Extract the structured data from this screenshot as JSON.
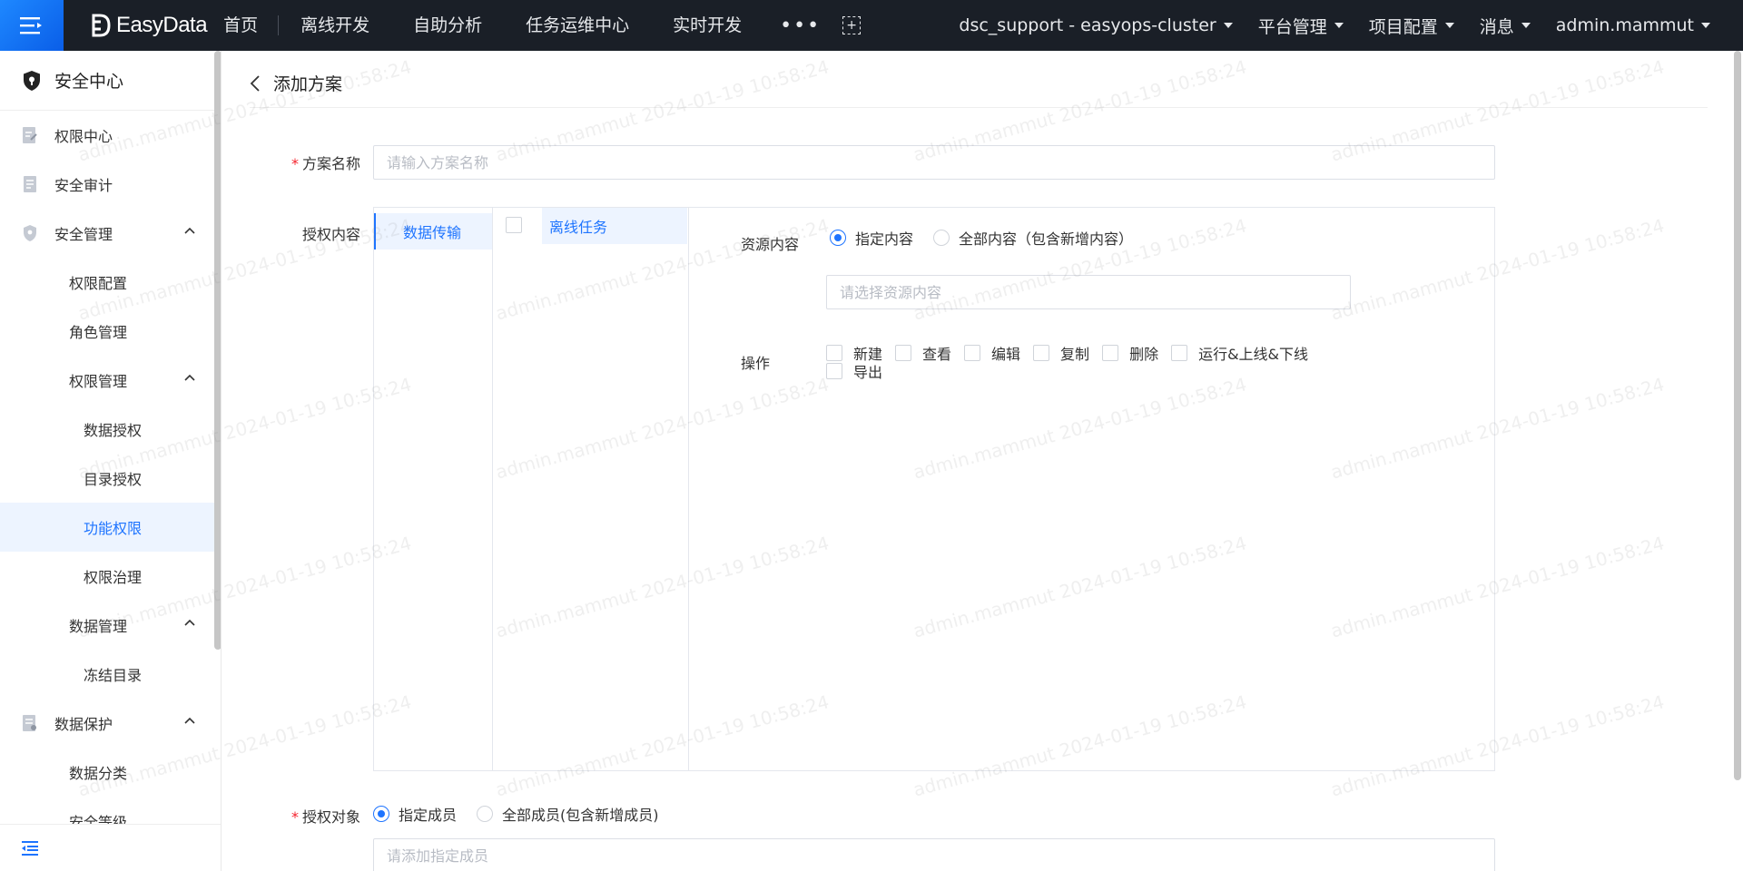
{
  "topbar": {
    "brand": "EasyData",
    "nav": [
      "首页",
      "离线开发",
      "自助分析",
      "任务运维中心",
      "实时开发"
    ],
    "more": "•••",
    "cluster": "dsc_support - easyops-cluster",
    "platform": "平台管理",
    "project": "项目配置",
    "messages": "消息",
    "user": "admin.mammut"
  },
  "sidebar": {
    "title": "安全中心",
    "items": [
      {
        "label": "权限中心",
        "level": 1
      },
      {
        "label": "安全审计",
        "level": 1
      },
      {
        "label": "安全管理",
        "level": 1,
        "expanded": true
      },
      {
        "label": "权限配置",
        "level": 2
      },
      {
        "label": "角色管理",
        "level": 2
      },
      {
        "label": "权限管理",
        "level": 2,
        "expanded": true
      },
      {
        "label": "数据授权",
        "level": 3
      },
      {
        "label": "目录授权",
        "level": 3
      },
      {
        "label": "功能权限",
        "level": 3,
        "active": true
      },
      {
        "label": "权限治理",
        "level": 3
      },
      {
        "label": "数据管理",
        "level": 2,
        "expanded": true
      },
      {
        "label": "冻结目录",
        "level": 3
      },
      {
        "label": "数据保护",
        "level": 1,
        "expanded": true
      },
      {
        "label": "数据分类",
        "level": 2
      },
      {
        "label": "安全等级",
        "level": 2
      }
    ]
  },
  "page": {
    "title": "添加方案",
    "scheme_name_label": "方案名称",
    "scheme_name_placeholder": "请输入方案名称",
    "auth_content_label": "授权内容",
    "category": "数据传输",
    "subcategory": "离线任务",
    "resource_label": "资源内容",
    "resource_opt_specified": "指定内容",
    "resource_opt_all": "全部内容（包含新增内容）",
    "resource_placeholder": "请选择资源内容",
    "ops_label": "操作",
    "ops": [
      "新建",
      "查看",
      "编辑",
      "复制",
      "删除",
      "运行&上线&下线",
      "导出"
    ],
    "target_label": "授权对象",
    "target_opt_specified": "指定成员",
    "target_opt_all": "全部成员(包含新增成员)",
    "target_placeholder": "请添加指定成员"
  },
  "watermark": "admin.mammut 2024-01-19 10:58:24",
  "colors": {
    "accent": "#1e74ff",
    "topbar": "#1a1f27",
    "active_bg": "#edf4ff"
  }
}
